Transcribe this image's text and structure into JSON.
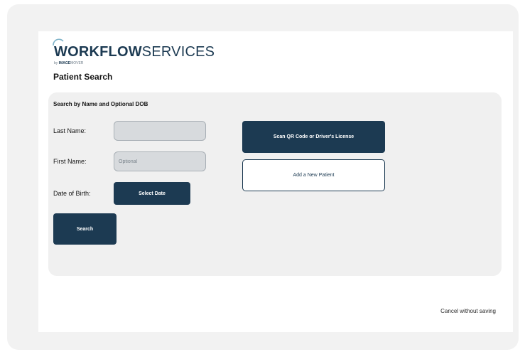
{
  "brand": {
    "name_bold": "WORKFLOW",
    "name_light": "SERVICES",
    "by_text": "by",
    "sub_bold": "IMAGE",
    "sub_light": "MOVER",
    "color": "#1c3a52",
    "arc_icon": "logo-arc-icon"
  },
  "page": {
    "title": "Patient Search"
  },
  "search": {
    "section_title": "Search by Name and Optional DOB",
    "last_name_label": "Last Name:",
    "last_name_value": "",
    "first_name_label": "First Name:",
    "first_name_placeholder": "Optional",
    "dob_label": "Date of Birth:",
    "select_date_label": "Select Date",
    "search_label": "Search"
  },
  "actions": {
    "scan_label": "Scan QR Code or Driver's License",
    "add_patient_label": "Add a New Patient",
    "cancel_label": "Cancel without saving"
  },
  "colors": {
    "primary": "#1c3a52",
    "panel": "#f0f0f0",
    "input_bg": "#d7dadd"
  }
}
